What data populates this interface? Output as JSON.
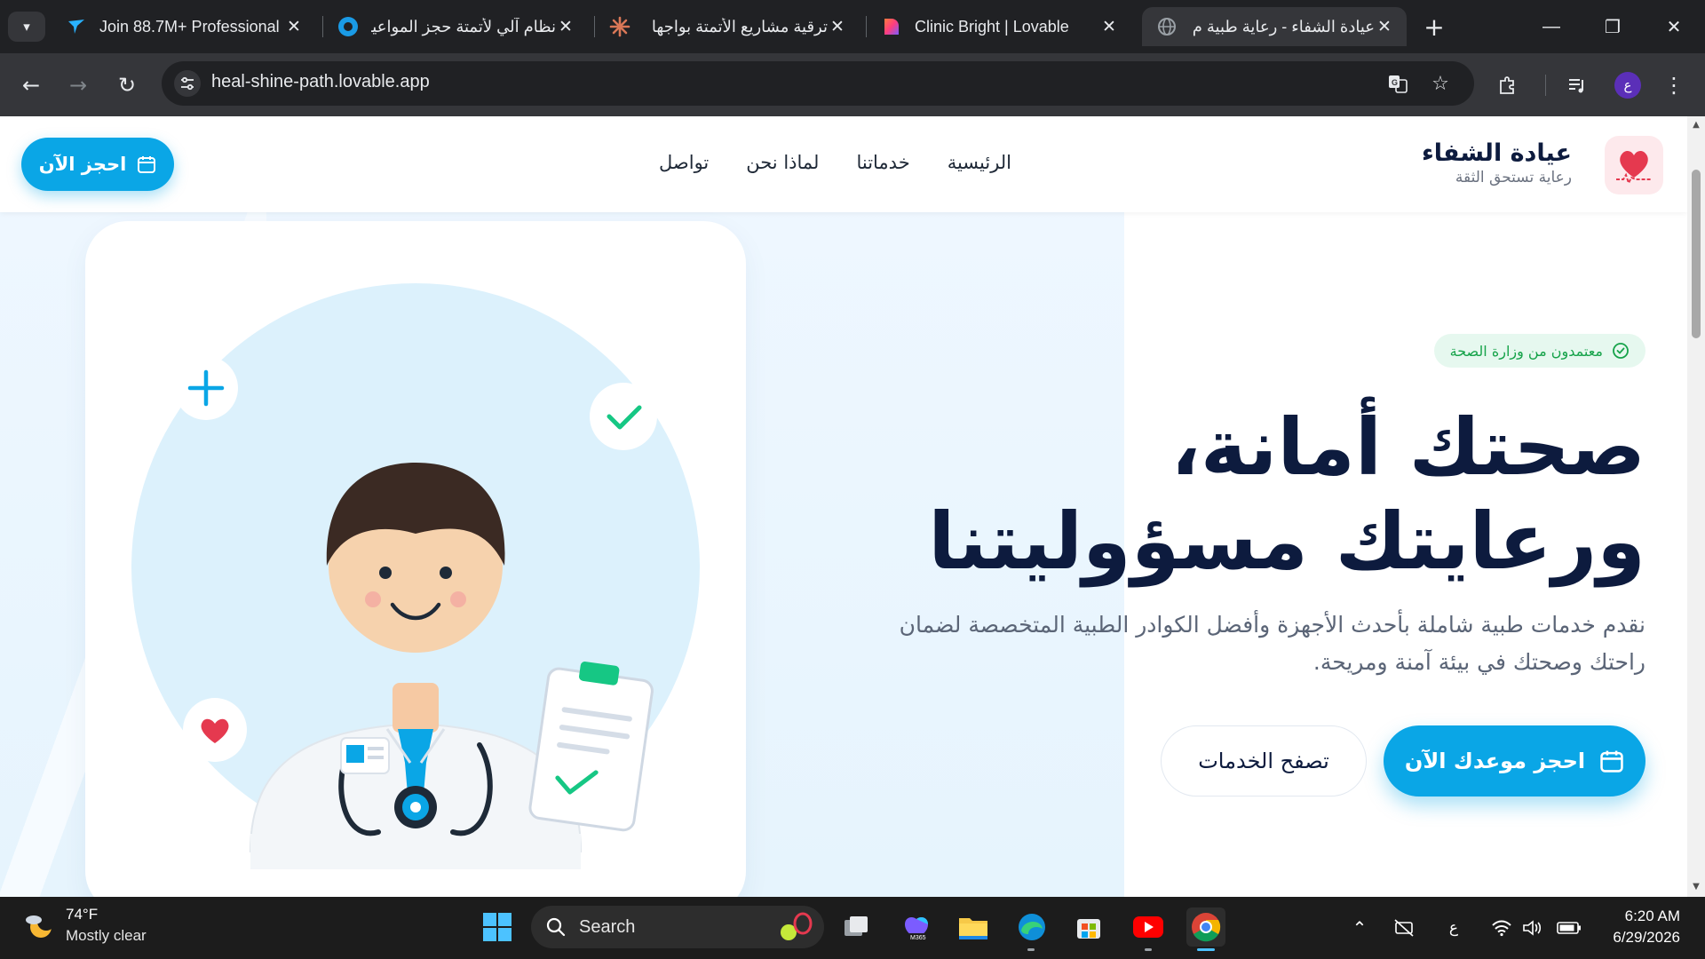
{
  "browser": {
    "tabs": [
      {
        "title": "Join 88.7M+ Professional",
        "active": false
      },
      {
        "title": "نظام آلي لأتمتة حجز المواعيد",
        "active": false
      },
      {
        "title": "ترقية مشاريع الأتمتة بواجها",
        "active": false
      },
      {
        "title": "Clinic Bright | Lovable",
        "active": false
      },
      {
        "title": "عيادة الشفاء - رعاية طبية م",
        "active": true
      }
    ],
    "url": "heal-shine-path.lovable.app",
    "profile_initial": "ع"
  },
  "site": {
    "brand_name": "عيادة الشفاء",
    "brand_tagline": "رعاية تستحق الثقة",
    "nav": [
      "الرئيسية",
      "خدماتنا",
      "لماذا نحن",
      "تواصل"
    ],
    "book_now": "احجز الآن",
    "badge": "معتمدون من وزارة الصحة",
    "headline_line1": "صحتك أمانة،",
    "headline_line2": "ورعايتك مسؤوليتنا",
    "subtitle": "نقدم خدمات طبية شاملة بأحدث الأجهزة وأفضل الكوادر الطبية المتخصصة لضمان راحتك وصحتك في بيئة آمنة ومريحة.",
    "primary_cta": "احجز موعدك الآن",
    "secondary_cta": "تصفح الخدمات",
    "colors": {
      "primary": "#0aa6e6",
      "navy": "#0d1b3e",
      "heart": "#e5394f",
      "green": "#16c784"
    }
  },
  "taskbar": {
    "temperature": "74°F",
    "weather": "Mostly clear",
    "search_placeholder": "Search",
    "ime": "ع",
    "time": "6:20 AM",
    "date": "6/29/2026"
  }
}
